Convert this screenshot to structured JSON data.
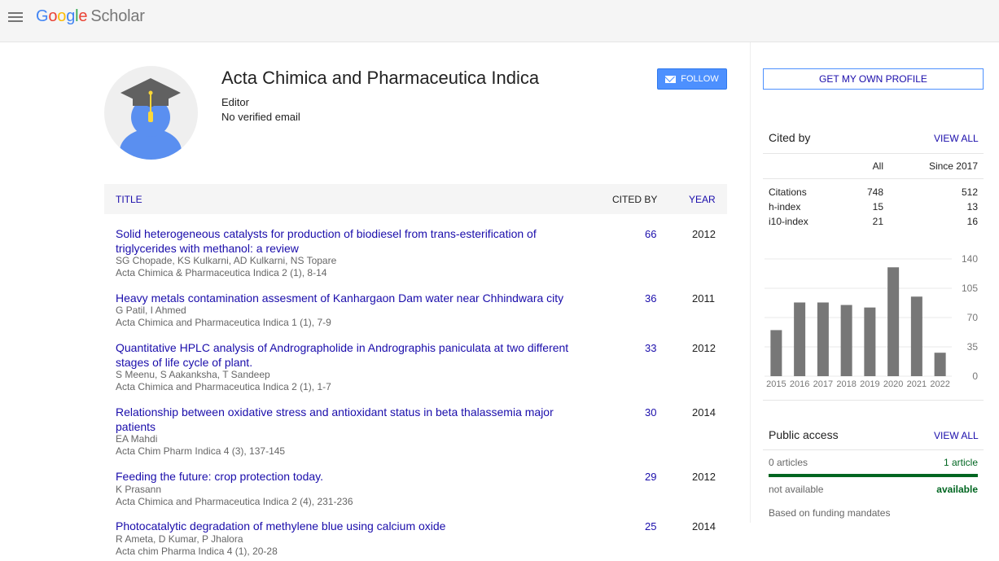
{
  "header": {
    "logo_google": [
      "G",
      "o",
      "o",
      "g",
      "l",
      "e"
    ],
    "logo_product": "Scholar"
  },
  "profile": {
    "name": "Acta Chimica and Pharmaceutica Indica",
    "affiliation": "Editor",
    "email": "No verified email",
    "follow_label": "FOLLOW"
  },
  "table": {
    "col_title": "TITLE",
    "col_cited": "CITED BY",
    "col_year": "YEAR",
    "rows": [
      {
        "title": "Solid heterogeneous catalysts for production of biodiesel from trans-esterification of triglycerides with methanol: a review",
        "authors": "SG Chopade, KS Kulkarni, AD Kulkarni, NS Topare",
        "venue": "Acta Chimica & Pharmaceutica Indica 2 (1), 8-14",
        "cited": "66",
        "year": "2012"
      },
      {
        "title": "Heavy metals contamination assesment of Kanhargaon Dam water near Chhindwara city",
        "authors": "G Patil, I Ahmed",
        "venue": "Acta Chimica and Pharmaceutica Indica 1 (1), 7-9",
        "cited": "36",
        "year": "2011"
      },
      {
        "title": "Quantitative HPLC analysis of Andrographolide in Andrographis paniculata at two different stages of life cycle of plant.",
        "authors": "S Meenu, S Aakanksha, T Sandeep",
        "venue": "Acta Chimica and Pharmaceutica Indica 2 (1), 1-7",
        "cited": "33",
        "year": "2012"
      },
      {
        "title": "Relationship between oxidative stress and antioxidant status in beta thalassemia major patients",
        "authors": "EA Mahdi",
        "venue": "Acta Chim Pharm Indica 4 (3), 137-145",
        "cited": "30",
        "year": "2014"
      },
      {
        "title": "Feeding the future: crop protection today.",
        "authors": "K Prasann",
        "venue": "Acta Chimica and Pharmaceutica Indica 2 (4), 231-236",
        "cited": "29",
        "year": "2012"
      },
      {
        "title": "Photocatalytic degradation of methylene blue using calcium oxide",
        "authors": "R Ameta, D Kumar, P Jhalora",
        "venue": "Acta chim Pharma Indica 4 (1), 20-28",
        "cited": "25",
        "year": "2014"
      }
    ]
  },
  "sidebar": {
    "own_profile_label": "GET MY OWN PROFILE",
    "cited_by": {
      "heading": "Cited by",
      "view_all": "VIEW ALL",
      "col_all": "All",
      "col_since": "Since 2017",
      "metrics": [
        {
          "label": "Citations",
          "all": "748",
          "since": "512"
        },
        {
          "label": "h-index",
          "all": "15",
          "since": "13"
        },
        {
          "label": "i10-index",
          "all": "21",
          "since": "16"
        }
      ]
    },
    "public_access": {
      "heading": "Public access",
      "view_all": "VIEW ALL",
      "left_count": "0 articles",
      "right_count": "1 article",
      "left_status": "not available",
      "right_status": "available",
      "note": "Based on funding mandates"
    }
  },
  "chart_data": {
    "type": "bar",
    "categories": [
      "2015",
      "2016",
      "2017",
      "2018",
      "2019",
      "2020",
      "2021",
      "2022"
    ],
    "values": [
      55,
      88,
      88,
      85,
      82,
      130,
      95,
      28
    ],
    "ylim": [
      0,
      140
    ],
    "yticks": [
      "0",
      "35",
      "70",
      "105",
      "140"
    ],
    "bar_color": "#777777",
    "grid": true
  },
  "colors": {
    "link": "#1a0dab",
    "follow_button": "#4d90fe",
    "available_green": "#006621"
  }
}
